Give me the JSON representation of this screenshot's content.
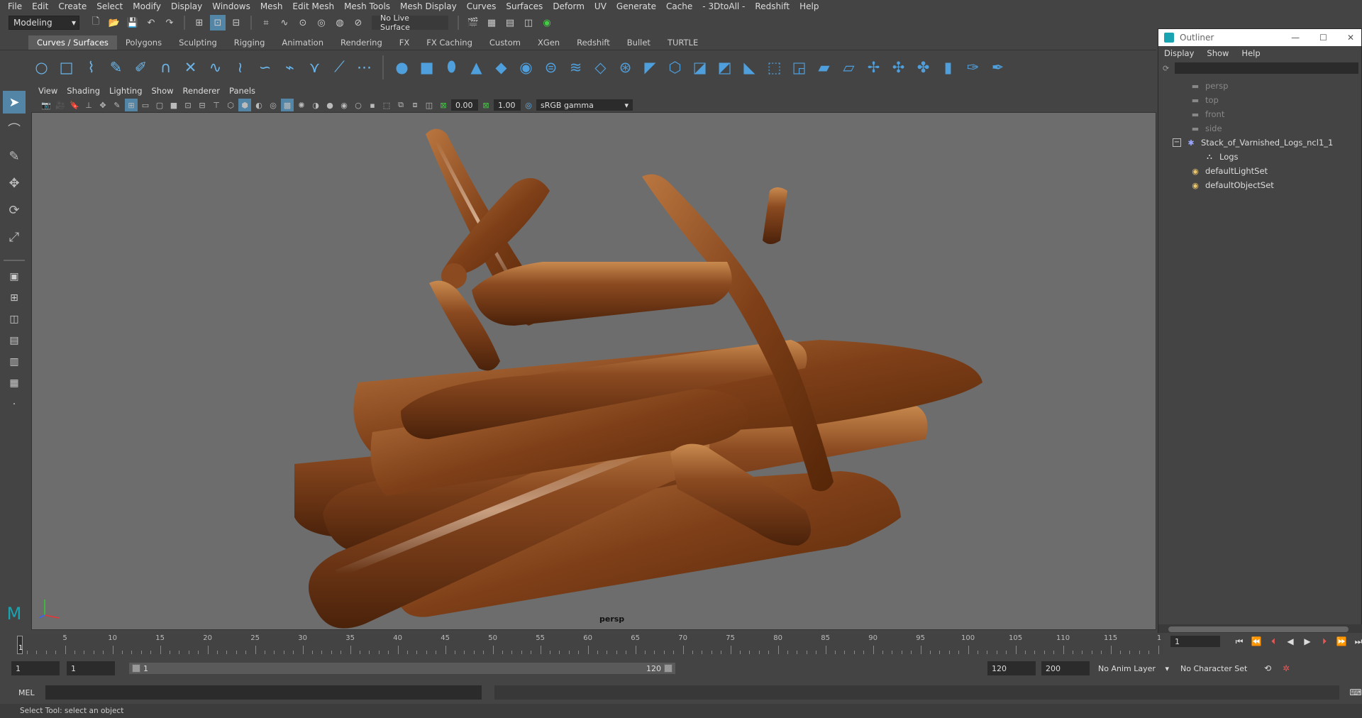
{
  "menubar": {
    "items": [
      "File",
      "Edit",
      "Create",
      "Select",
      "Modify",
      "Display",
      "Windows",
      "Mesh",
      "Edit Mesh",
      "Mesh Tools",
      "Mesh Display",
      "Curves",
      "Surfaces",
      "Deform",
      "UV",
      "Generate",
      "Cache",
      "- 3DtoAll -",
      "Redshift",
      "Help"
    ]
  },
  "statusline": {
    "mode": "Modeling",
    "live_surface": "No Live Surface"
  },
  "shelf": {
    "tabs": [
      "Curves / Surfaces",
      "Polygons",
      "Sculpting",
      "Rigging",
      "Animation",
      "Rendering",
      "FX",
      "FX Caching",
      "Custom",
      "XGen",
      "Redshift",
      "Bullet",
      "TURTLE"
    ],
    "active_tab": "Curves / Surfaces"
  },
  "panel": {
    "menu": [
      "View",
      "Shading",
      "Lighting",
      "Show",
      "Renderer",
      "Panels"
    ],
    "exposure": "0.00",
    "gamma": "1.00",
    "color_space": "sRGB gamma",
    "camera_label": "persp"
  },
  "outliner": {
    "title": "Outliner",
    "menu": [
      "Display",
      "Show",
      "Help"
    ],
    "items": [
      {
        "label": "persp",
        "dim": true
      },
      {
        "label": "top",
        "dim": true
      },
      {
        "label": "front",
        "dim": true
      },
      {
        "label": "side",
        "dim": true
      },
      {
        "label": "Stack_of_Varnished_Logs_ncl1_1",
        "dim": false
      },
      {
        "label": "Logs",
        "dim": false
      },
      {
        "label": "defaultLightSet",
        "dim": false
      },
      {
        "label": "defaultObjectSet",
        "dim": false
      }
    ]
  },
  "timeline": {
    "ticks": [
      "5",
      "10",
      "15",
      "20",
      "25",
      "30",
      "35",
      "40",
      "45",
      "50",
      "55",
      "60",
      "65",
      "70",
      "75",
      "80",
      "85",
      "90",
      "95",
      "100",
      "105",
      "110",
      "115",
      "1"
    ],
    "current_frame": "1",
    "current_frame_field": "1"
  },
  "range": {
    "start": "1",
    "playback_start": "1",
    "bar_start": "1",
    "bar_end": "120",
    "playback_end": "120",
    "end": "200",
    "anim_layer": "No Anim Layer",
    "character_set": "No Character Set"
  },
  "cmdline": {
    "label": "MEL"
  },
  "helpline": {
    "text": "Select Tool: select an object"
  }
}
